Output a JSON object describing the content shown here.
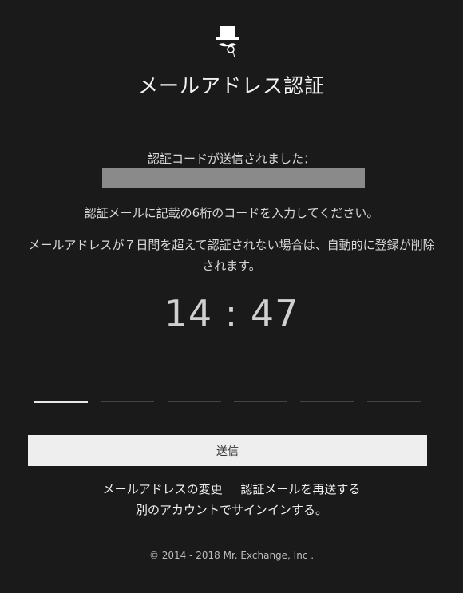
{
  "logo": {
    "icon": "top-hat-mustache-icon"
  },
  "title": "メールアドレス認証",
  "sent_label": "認証コードが送信されました：",
  "instruction": "認証メールに記載の6桁のコードを入力してください。",
  "warning": "メールアドレスが７日間を超えて認証されない場合は、自動的に登録が削除されます。",
  "timer": "14 : 47",
  "code_inputs": {
    "count": 6,
    "active_index": 0,
    "values": [
      "",
      "",
      "",
      "",
      "",
      ""
    ]
  },
  "submit_label": "送信",
  "links": {
    "change_email": "メールアドレスの変更",
    "resend": "認証メールを再送する",
    "other_account": "別のアカウントでサインインする。"
  },
  "footer": "© 2014 - 2018 Mr. Exchange, Inc ."
}
